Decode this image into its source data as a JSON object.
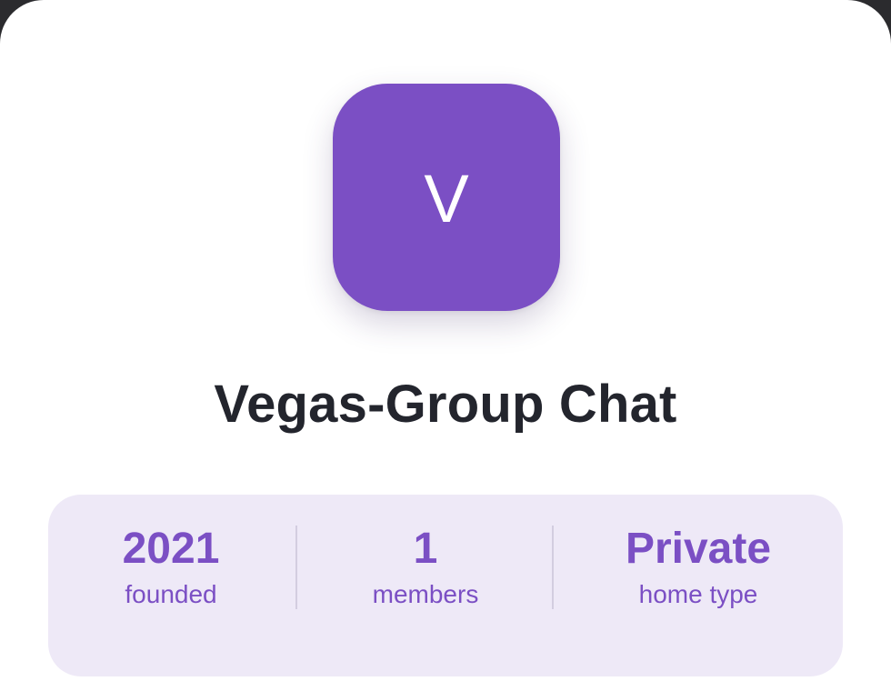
{
  "group": {
    "icon_letter": "V",
    "title": "Vegas-Group Chat"
  },
  "stats": {
    "founded": {
      "value": "2021",
      "label": "founded"
    },
    "members": {
      "value": "1",
      "label": "members"
    },
    "home_type": {
      "value": "Private",
      "label": "home type"
    }
  },
  "colors": {
    "accent": "#7b4fc4",
    "stats_background": "#eee9f7",
    "title_text": "#23252d"
  }
}
